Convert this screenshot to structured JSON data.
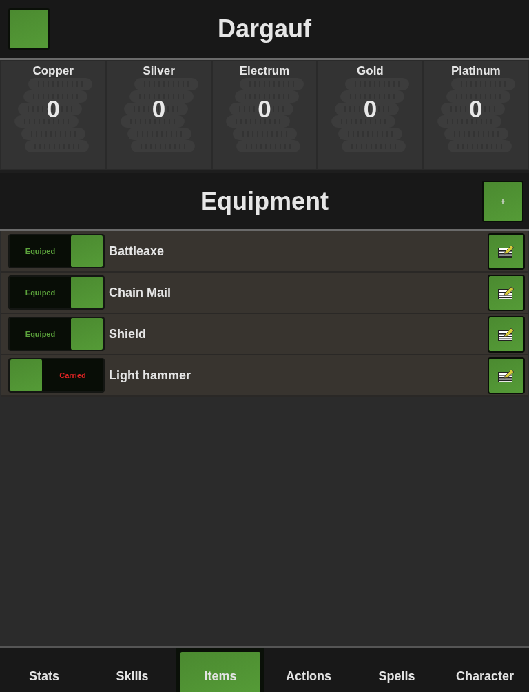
{
  "header": {
    "title": "Dargauf"
  },
  "coins": [
    {
      "label": "Copper",
      "value": "0"
    },
    {
      "label": "Silver",
      "value": "0"
    },
    {
      "label": "Electrum",
      "value": "0"
    },
    {
      "label": "Gold",
      "value": "0"
    },
    {
      "label": "Platinum",
      "value": "0"
    }
  ],
  "equipment": {
    "title": "Equipment",
    "add_label": "+",
    "items": [
      {
        "name": "Battleaxe",
        "status": "Equiped",
        "on": true
      },
      {
        "name": "Chain Mail",
        "status": "Equiped",
        "on": true
      },
      {
        "name": "Shield",
        "status": "Equiped",
        "on": true
      },
      {
        "name": "Light hammer",
        "status": "Carried",
        "on": false
      }
    ]
  },
  "tabs": [
    {
      "label": "Stats",
      "selected": false
    },
    {
      "label": "Skills",
      "selected": false
    },
    {
      "label": "Items",
      "selected": true
    },
    {
      "label": "Actions",
      "selected": false
    },
    {
      "label": "Spells",
      "selected": false
    },
    {
      "label": "Character",
      "selected": false
    }
  ]
}
